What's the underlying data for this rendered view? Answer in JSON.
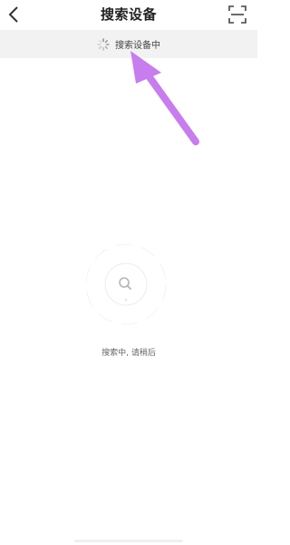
{
  "header": {
    "title": "搜索设备",
    "back_icon": "chevron-left-icon",
    "scan_icon": "scan-icon"
  },
  "status": {
    "text": "搜索设备中",
    "icon": "loading-spinner-icon"
  },
  "main": {
    "searching_text": "搜索中, 请稍后",
    "radar_icon": "search-icon"
  },
  "annotation": {
    "arrow_color": "#c77dee"
  }
}
